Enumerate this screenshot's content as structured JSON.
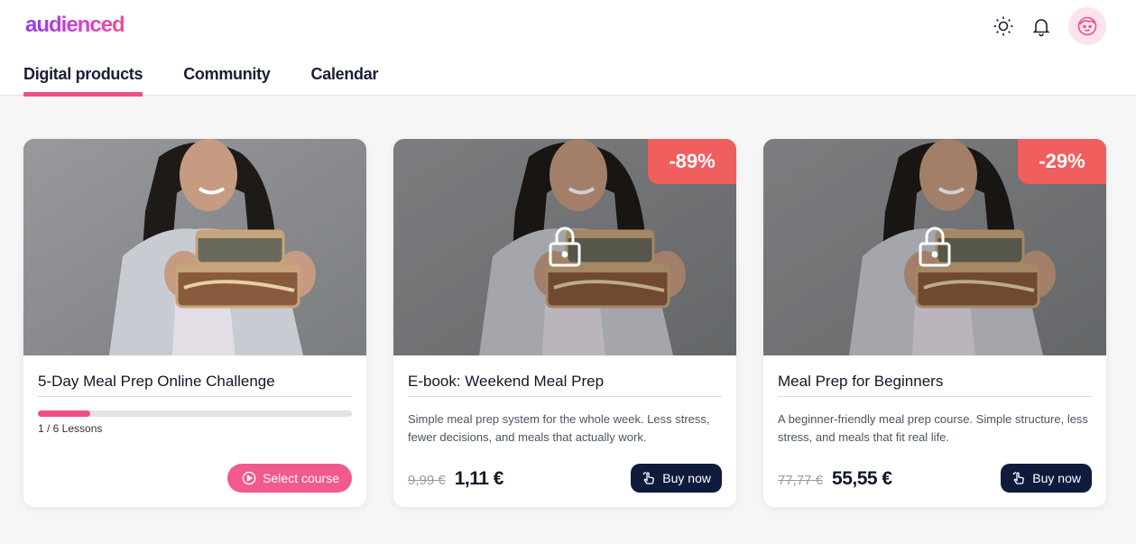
{
  "brand": {
    "logo_text": "audienced"
  },
  "header": {
    "icons": [
      "theme-toggle-icon",
      "bell-icon",
      "avatar-icon"
    ]
  },
  "tabs": [
    {
      "label": "Digital products",
      "active": true
    },
    {
      "label": "Community",
      "active": false
    },
    {
      "label": "Calendar",
      "active": false
    }
  ],
  "colors": {
    "accent": "#f04f86",
    "badge": "#f15e5e",
    "dark_button": "#0f1b3d"
  },
  "cards": [
    {
      "title": "5-Day Meal Prep Online Challenge",
      "progress_label": "1 / 6 Lessons",
      "progress": 0.167,
      "locked": false,
      "button_label": "Select course",
      "button_icon": "play-circle-icon"
    },
    {
      "title": "E-book: Weekend Meal Prep",
      "badge": "-89%",
      "locked": true,
      "description": "Simple meal prep system for the whole week. Less stress, fewer decisions, and meals that actually work.",
      "old_price": "9,99 €",
      "price": "1,11 €",
      "button_label": "Buy now",
      "button_icon": "hand-tap-icon"
    },
    {
      "title": "Meal Prep for Beginners",
      "badge": "-29%",
      "locked": true,
      "description": "A beginner-friendly meal prep course. Simple structure, less stress, and meals that fit real life.",
      "old_price": "77,77 €",
      "price": "55,55 €",
      "button_label": "Buy now",
      "button_icon": "hand-tap-icon"
    }
  ]
}
